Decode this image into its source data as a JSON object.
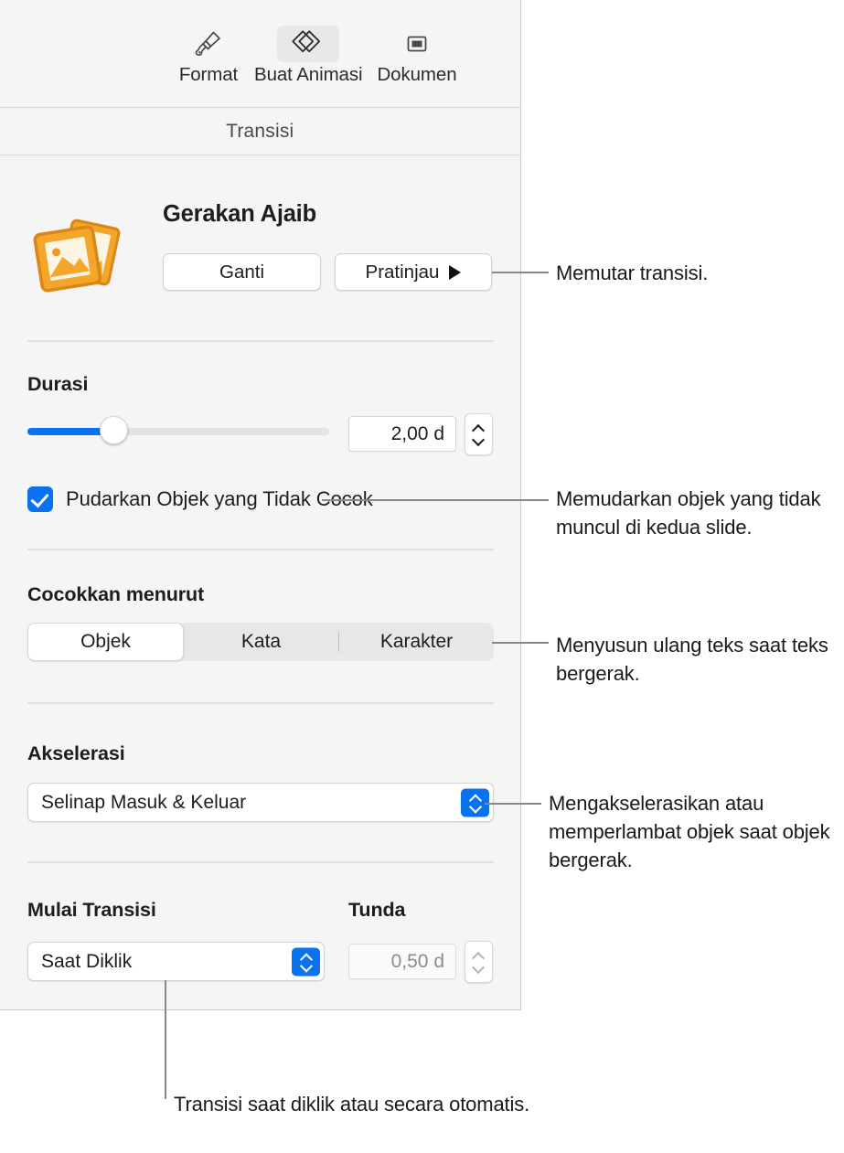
{
  "toolbar": {
    "tabs": [
      {
        "label": "Format",
        "icon": "paintbrush-icon",
        "selected": false
      },
      {
        "label": "Buat Animasi",
        "icon": "transition-diamonds-icon",
        "selected": true
      },
      {
        "label": "Dokumen",
        "icon": "document-icon",
        "selected": false
      }
    ]
  },
  "section": {
    "title": "Transisi"
  },
  "transition": {
    "icon": "transition-photos-icon",
    "name": "Gerakan Ajaib",
    "change_button": "Ganti",
    "preview_button": "Pratinjau",
    "preview_icon": "play-icon"
  },
  "duration": {
    "label": "Durasi",
    "value": "2,00 d",
    "slider_percent": 29
  },
  "fade": {
    "label": "Pudarkan Objek yang Tidak Cocok",
    "checked": true
  },
  "match": {
    "label": "Cocokkan menurut",
    "options": [
      "Objek",
      "Kata",
      "Karakter"
    ],
    "selected": "Objek"
  },
  "acceleration": {
    "label": "Akselerasi",
    "value": "Selinap Masuk & Keluar"
  },
  "start": {
    "label": "Mulai Transisi",
    "value": "Saat Diklik"
  },
  "delay": {
    "label": "Tunda",
    "value": "0,50 d",
    "disabled": true
  },
  "callouts": {
    "preview": "Memutar transisi.",
    "fade": "Memudarkan objek yang tidak muncul di kedua slide.",
    "match": "Menyusun ulang teks saat teks bergerak.",
    "acceleration": "Mengakselerasikan atau memperlambat objek saat objek bergerak.",
    "start": "Transisi saat diklik atau secara otomatis."
  },
  "colors": {
    "accent": "#0a72ee",
    "panel_bg": "#f5f5f5",
    "icon_orange": "#eb9117",
    "leader": "#888888"
  }
}
